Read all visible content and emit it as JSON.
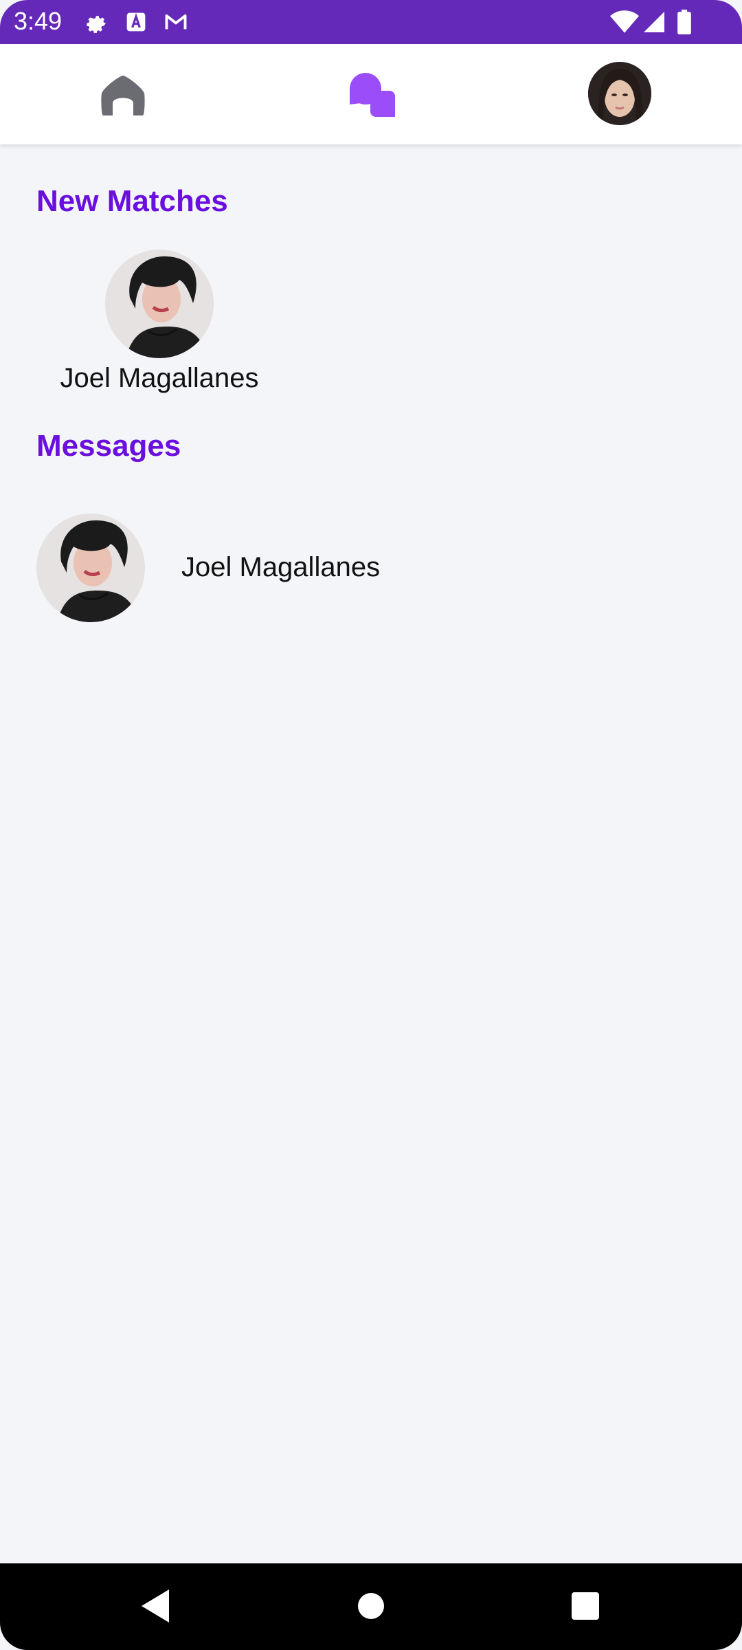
{
  "status_bar": {
    "time": "3:49",
    "left_icons": [
      "settings-icon",
      "text-a-icon",
      "gmail-icon"
    ],
    "right_icons": [
      "wifi-icon",
      "signal-icon",
      "battery-icon"
    ],
    "background": "#6529b9"
  },
  "top_nav": {
    "items": [
      {
        "name": "home",
        "icon": "home-icon",
        "active": false
      },
      {
        "name": "chat",
        "icon": "chat-bubbles-icon",
        "active": true
      },
      {
        "name": "profile",
        "icon": "profile-avatar",
        "active": false
      }
    ],
    "active_color": "#9b4dfa",
    "inactive_color": "#6b6b72"
  },
  "new_matches": {
    "title": "New Matches",
    "items": [
      {
        "name": "Joel Magallanes"
      }
    ]
  },
  "messages": {
    "title": "Messages",
    "items": [
      {
        "name": "Joel Magallanes"
      }
    ]
  },
  "system_nav": {
    "buttons": [
      "back-icon",
      "home-circle-icon",
      "recents-square-icon"
    ]
  },
  "colors": {
    "accent": "#6a0fdd",
    "background": "#f4f5f9"
  }
}
